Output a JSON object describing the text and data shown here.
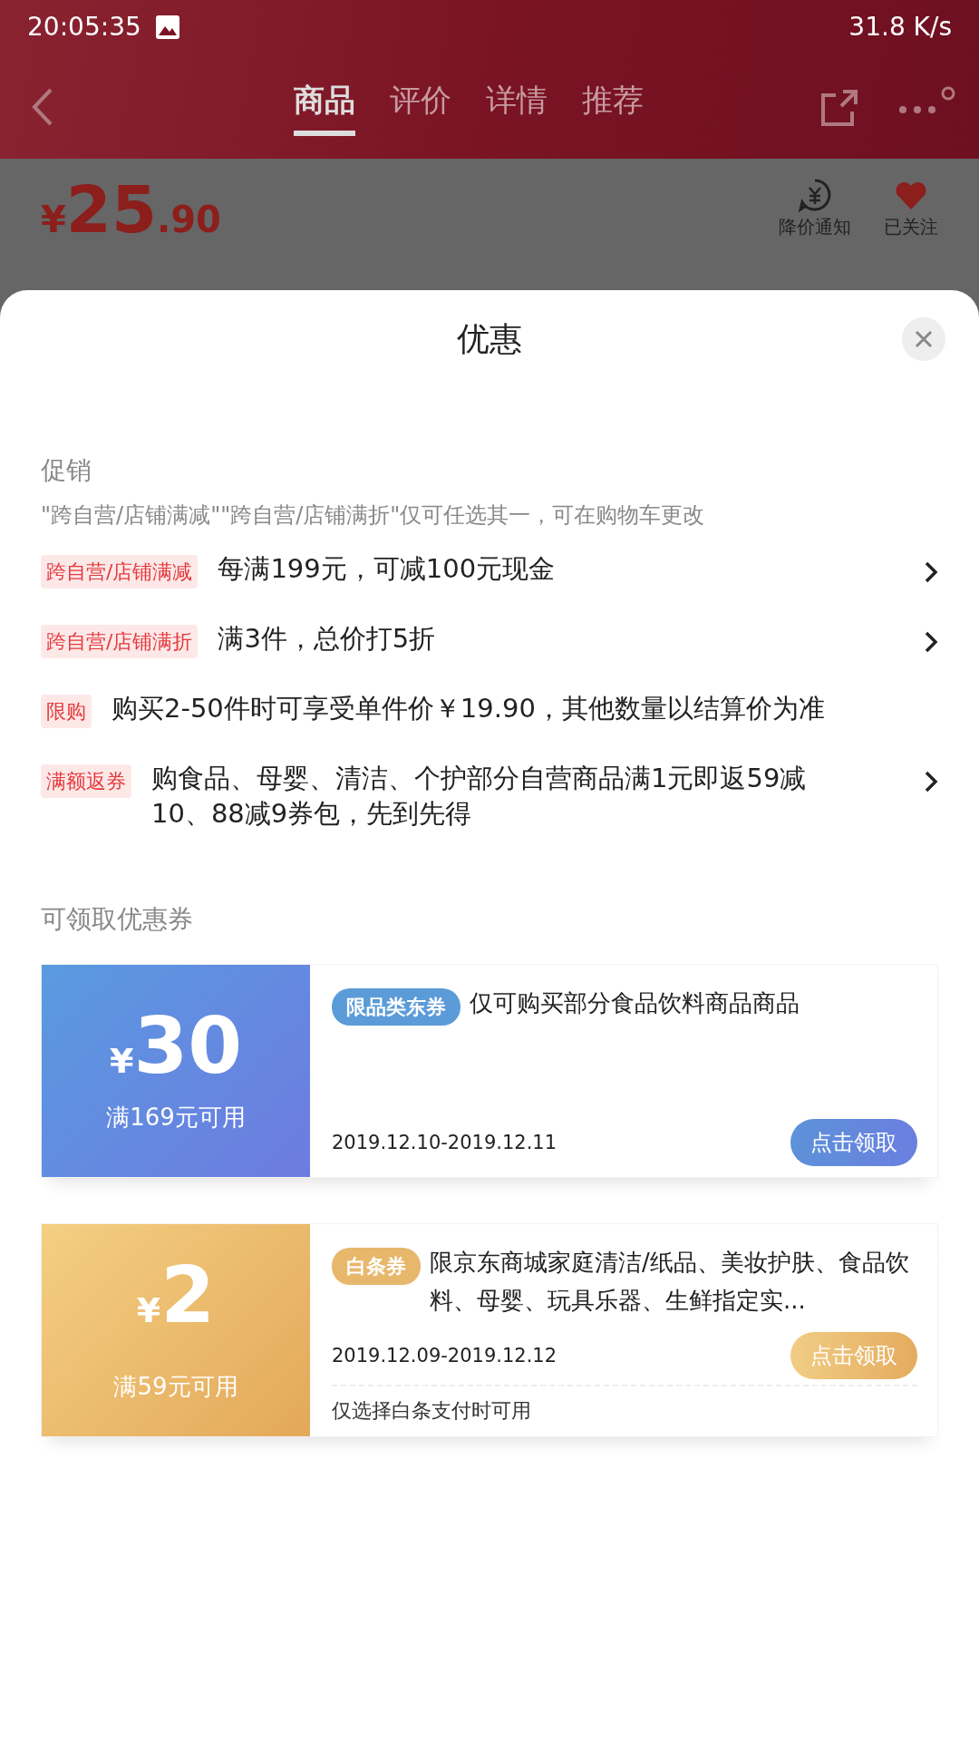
{
  "status_bar": {
    "time": "20:05:35",
    "speed": "31.8 K/s"
  },
  "header": {
    "tabs": [
      {
        "label": "商品",
        "selected": true
      },
      {
        "label": "评价",
        "selected": false
      },
      {
        "label": "详情",
        "selected": false
      },
      {
        "label": "推荐",
        "selected": false
      }
    ]
  },
  "product": {
    "currency": "¥",
    "price_integer": "25",
    "price_decimal": ".90",
    "actions": [
      {
        "kind": "price-alert",
        "label": "降价通知"
      },
      {
        "kind": "follow",
        "label": "已关注"
      }
    ]
  },
  "sheet": {
    "title": "优惠",
    "promotion_title": "促销",
    "promotion_note": "\"跨自营/店铺满减\"\"跨自营/店铺满折\"仅可任选其一，可在购物车更改",
    "promotions": [
      {
        "tag": "跨自营/店铺满减",
        "text": "每满199元，可减100元现金",
        "has_arrow": true
      },
      {
        "tag": "跨自营/店铺满折",
        "text": "满3件，总价打5折",
        "has_arrow": true
      },
      {
        "tag": "限购",
        "text": "购买2-50件时可享受单件价￥19.90，其他数量以结算价为准",
        "has_arrow": false
      },
      {
        "tag": "满额返券",
        "text": "购食品、母婴、清洁、个护部分自营商品满1元即返59减10、88减9券包，先到先得",
        "has_arrow": true
      }
    ],
    "coupon_title": "可领取优惠券",
    "coupons": [
      {
        "kind": "blue",
        "currency": "¥",
        "amount": "30",
        "condition": "满169元可用",
        "tag": "限品类东券",
        "description": "仅可购买部分食品饮料商品商品",
        "dates": "2019.12.10-2019.12.11",
        "button": "点击领取"
      },
      {
        "kind": "gold",
        "currency": "¥",
        "amount": "2",
        "condition": "满59元可用",
        "tag": "白条券",
        "description": "限京东商城家庭清洁/纸品、美妆护肤、食品饮料、母婴、玩具乐器、生鲜指定实...",
        "dates": "2019.12.09-2019.12.12",
        "button": "点击领取",
        "note": "仅选择白条支付时可用"
      }
    ]
  }
}
